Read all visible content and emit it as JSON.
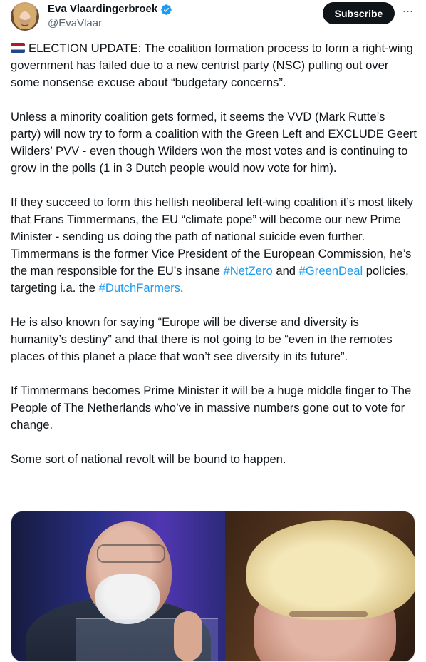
{
  "author": {
    "display_name": "Eva Vlaardingerbroek",
    "handle": "@EvaVlaar",
    "verified": true,
    "avatar_icon": "user-avatar"
  },
  "actions": {
    "subscribe_label": "Subscribe",
    "more_icon": "more-options-icon",
    "more_glyph": "···"
  },
  "colors": {
    "link": "#1d9bf0",
    "verified": "#1d9bf0",
    "subscribe_bg": "#0f1419",
    "text": "#0f1419",
    "secondary_text": "#536471"
  },
  "tweet": {
    "flag_icon": "netherlands-flag-icon",
    "p1": "ELECTION UPDATE: The coalition formation process to form a right-wing government has failed due to a new centrist party (NSC) pulling out over some nonsense excuse about “budgetary concerns”.",
    "p2": "Unless a minority coalition gets formed, it seems the VVD (Mark Rutte’s party) will now try to form a coalition with the Green Left and EXCLUDE Geert Wilders’ PVV - even though Wilders won the most votes and is continuing to grow in the polls (1 in 3 Dutch people would now vote for him).",
    "p3_before": "If they succeed to form this hellish neoliberal left-wing coalition it’s most likely that Frans Timmermans, the EU “climate pope” will become our new Prime Minister - sending us doing the path of national suicide even further. Timmermans is the former Vice President of the European Commission, he’s the man responsible for the EU’s insane ",
    "hashtag_netzero": "#NetZero",
    "p3_and": " and ",
    "hashtag_greendeal": "#GreenDeal",
    "p3_middle": " policies, targeting i.a. the ",
    "hashtag_dutchfarmers": "#DutchFarmers",
    "p3_end": ".",
    "p4": "He is also known for saying “Europe will be diverse and diversity is humanity’s destiny” and that there is not going to be “even in the remotes places of this planet a place that won’t see diversity in its future”.",
    "p5": "If Timmermans becomes Prime Minister it will be a huge middle finger to The People of The Netherlands who’ve in massive numbers gone out to vote for change.",
    "p6": "Some sort of national revolt will be bound to happen."
  },
  "media": {
    "left_photo": "photo-frans-timmermans",
    "right_photo": "photo-geert-wilders"
  }
}
